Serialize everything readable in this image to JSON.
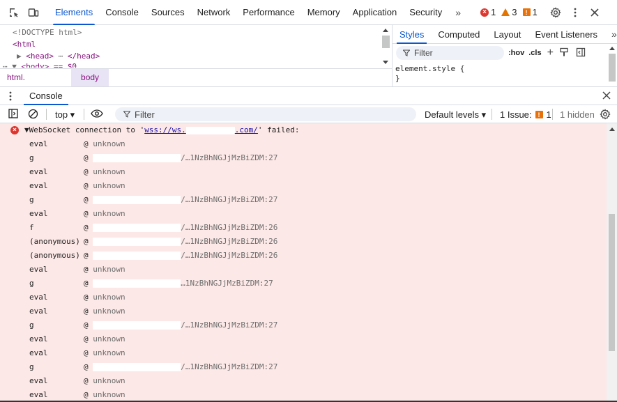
{
  "topbar": {
    "tabs": [
      "Elements",
      "Console",
      "Sources",
      "Network",
      "Performance",
      "Memory",
      "Application",
      "Security"
    ],
    "active_tab": "Elements",
    "more": "»",
    "errors": "1",
    "warnings": "3",
    "issues": "1"
  },
  "elements": {
    "lines": [
      "<!DOCTYPE html>",
      "<html",
      "<head>",
      "</head>",
      "<body> == $0"
    ],
    "crumbs": [
      "html.",
      "body"
    ]
  },
  "styles": {
    "tabs": [
      "Styles",
      "Computed",
      "Layout",
      "Event Listeners"
    ],
    "active_tab": "Styles",
    "filter_placeholder": "Filter",
    "hov": ":hov",
    "cls": ".cls",
    "rule_open": "element.style {",
    "rule_close": "}"
  },
  "drawer": {
    "tab": "Console"
  },
  "console_toolbar": {
    "context": "top ▾",
    "filter_placeholder": "Filter",
    "levels": "Default levels ▾",
    "issues_label": "1 Issue:",
    "issues_count": "1",
    "hidden": "1 hidden"
  },
  "console": {
    "error_prefix": "▼WebSocket connection to '",
    "error_link_a": "wss://ws.",
    "error_link_b": ".com/",
    "error_suffix": "' failed:",
    "frames": [
      {
        "fn": "eval",
        "loc": "unknown",
        "redacted": false
      },
      {
        "fn": "g",
        "loc": "/…1NzBhNGJjMzBiZDM:27",
        "redacted": true
      },
      {
        "fn": "eval",
        "loc": "unknown",
        "redacted": false
      },
      {
        "fn": "eval",
        "loc": "unknown",
        "redacted": false
      },
      {
        "fn": "g",
        "loc": "/…1NzBhNGJjMzBiZDM:27",
        "redacted": true
      },
      {
        "fn": "eval",
        "loc": "unknown",
        "redacted": false
      },
      {
        "fn": "f",
        "loc": "/…1NzBhNGJjMzBiZDM:26",
        "redacted": true
      },
      {
        "fn": "(anonymous)",
        "loc": "/…1NzBhNGJjMzBiZDM:26",
        "redacted": true
      },
      {
        "fn": "(anonymous)",
        "loc": "/…1NzBhNGJjMzBiZDM:26",
        "redacted": true
      },
      {
        "fn": "eval",
        "loc": "unknown",
        "redacted": false
      },
      {
        "fn": "g",
        "loc": "…1NzBhNGJjMzBiZDM:27",
        "redacted": true
      },
      {
        "fn": "eval",
        "loc": "unknown",
        "redacted": false
      },
      {
        "fn": "eval",
        "loc": "unknown",
        "redacted": false
      },
      {
        "fn": "g",
        "loc": "/…1NzBhNGJjMzBiZDM:27",
        "redacted": true
      },
      {
        "fn": "eval",
        "loc": "unknown",
        "redacted": false
      },
      {
        "fn": "eval",
        "loc": "unknown",
        "redacted": false
      },
      {
        "fn": "g",
        "loc": "/…1NzBhNGJjMzBiZDM:27",
        "redacted": true
      },
      {
        "fn": "eval",
        "loc": "unknown",
        "redacted": false
      },
      {
        "fn": "eval",
        "loc": "unknown",
        "redacted": false
      }
    ],
    "at_sign": "@"
  },
  "colors": {
    "accent": "#0b57d0",
    "error_bg": "#fce8e6",
    "error_red": "#dc362e",
    "warning_orange": "#e37400"
  }
}
